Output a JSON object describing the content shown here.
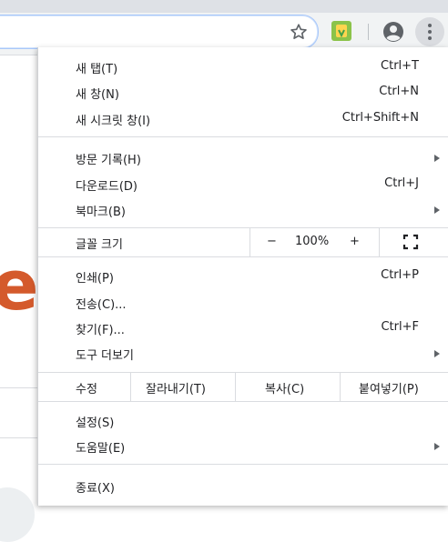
{
  "toolbar": {
    "star_icon": "bookmark-star-icon",
    "extension_icon": "extension-icon",
    "profile_icon": "account-circle-icon",
    "menu_icon": "three-dots-vertical-icon"
  },
  "page": {
    "partial_letter": "e"
  },
  "menu": {
    "group1": [
      {
        "label": "새 탭(T)",
        "accel": "Ctrl+T"
      },
      {
        "label": "새 창(N)",
        "accel": "Ctrl+N"
      },
      {
        "label": "새 시크릿 창(I)",
        "accel": "Ctrl+Shift+N"
      }
    ],
    "group2": [
      {
        "label": "방문 기록(H)",
        "accel": ""
      },
      {
        "label": "다운로드(D)",
        "accel": "Ctrl+J"
      },
      {
        "label": "북마크(B)",
        "accel": ""
      }
    ],
    "zoom": {
      "label": "글꼴 크기",
      "minus": "−",
      "value": "100%",
      "plus": "+"
    },
    "group3": [
      {
        "label": "인쇄(P)",
        "accel": "Ctrl+P"
      },
      {
        "label": "전송(C)...",
        "accel": ""
      },
      {
        "label": "찾기(F)...",
        "accel": "Ctrl+F"
      },
      {
        "label": "도구 더보기",
        "accel": ""
      }
    ],
    "edit": {
      "label": "수정",
      "cut": "잘라내기(T)",
      "copy": "복사(C)",
      "paste": "붙여넣기(P)"
    },
    "group4": [
      {
        "label": "설정(S)"
      },
      {
        "label": "도움말(E)"
      }
    ],
    "exit": {
      "label": "종료(X)"
    }
  },
  "colors": {
    "accent_orange": "#d45a2c",
    "menu_bg": "#ffffff",
    "toolbar_bg": "#f1f3f4"
  }
}
